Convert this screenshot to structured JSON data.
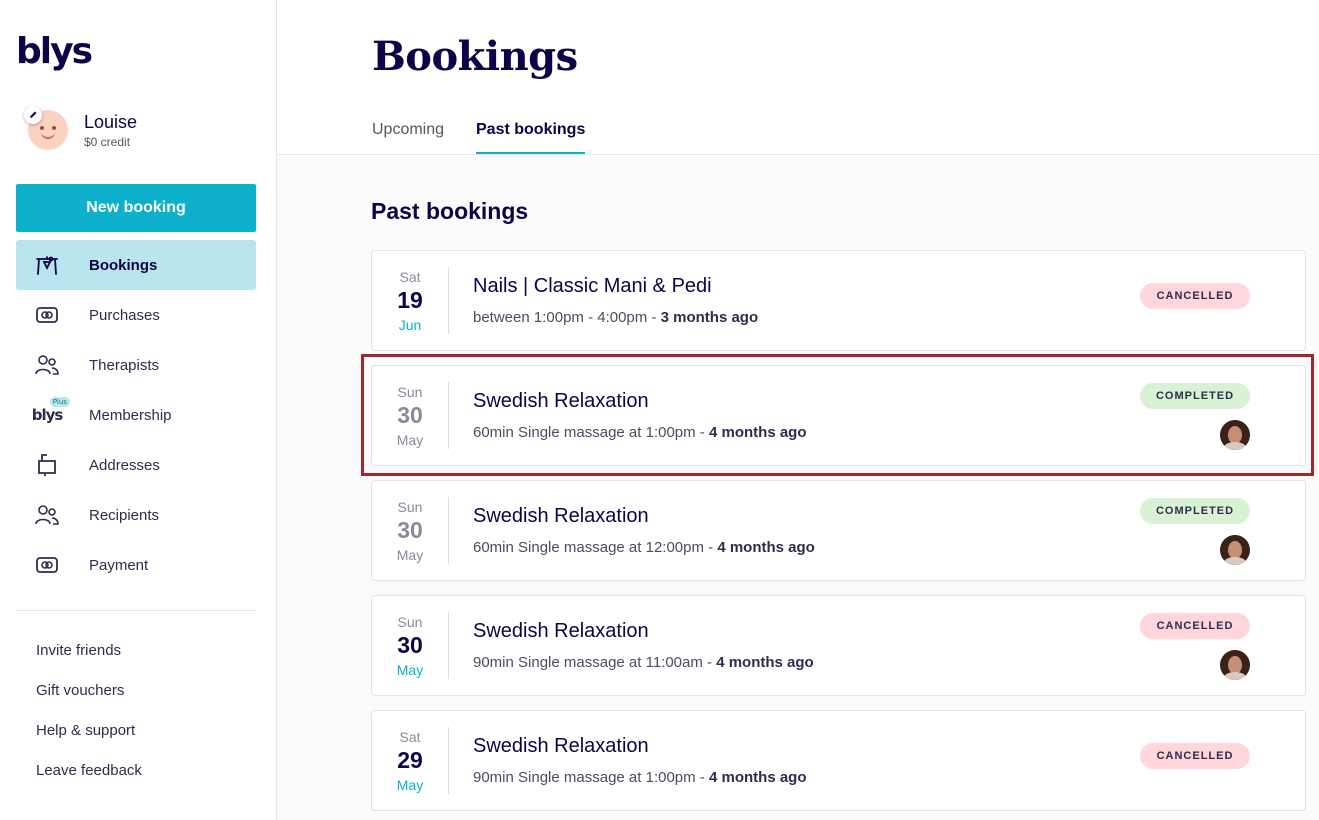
{
  "logo": "blys",
  "user": {
    "name": "Louise",
    "credit": "$0 credit"
  },
  "sidebar": {
    "new_booking_label": "New booking",
    "items": [
      {
        "label": "Bookings",
        "icon": "bookings-icon",
        "active": true
      },
      {
        "label": "Purchases",
        "icon": "purchases-icon",
        "active": false
      },
      {
        "label": "Therapists",
        "icon": "therapists-icon",
        "active": false
      },
      {
        "label": "Membership",
        "icon": "blys-plus-icon",
        "active": false
      },
      {
        "label": "Addresses",
        "icon": "mailbox-icon",
        "active": false
      },
      {
        "label": "Recipients",
        "icon": "recipients-icon",
        "active": false
      },
      {
        "label": "Payment",
        "icon": "payment-icon",
        "active": false
      }
    ],
    "plus_logo": "blys",
    "plus_tag": "Plus",
    "footer_links": [
      "Invite friends",
      "Gift vouchers",
      "Help & support",
      "Leave feedback"
    ]
  },
  "header": {
    "title": "Bookings",
    "tabs": [
      {
        "label": "Upcoming",
        "active": false
      },
      {
        "label": "Past bookings",
        "active": true
      }
    ]
  },
  "main": {
    "section_title": "Past bookings",
    "bookings": [
      {
        "dow": "Sat",
        "day": "19",
        "month": "Jun",
        "title": "Nails | Classic Mani & Pedi",
        "detail": "between 1:00pm - 4:00pm",
        "ago": "3 months ago",
        "status": "CANCELLED",
        "has_pro": false
      },
      {
        "dow": "Sun",
        "day": "30",
        "month": "May",
        "title": "Swedish Relaxation",
        "detail": "60min Single massage at 1:00pm",
        "ago": "4 months ago",
        "status": "COMPLETED",
        "has_pro": true
      },
      {
        "dow": "Sun",
        "day": "30",
        "month": "May",
        "title": "Swedish Relaxation",
        "detail": "60min Single massage at 12:00pm",
        "ago": "4 months ago",
        "status": "COMPLETED",
        "has_pro": true
      },
      {
        "dow": "Sun",
        "day": "30",
        "month": "May",
        "title": "Swedish Relaxation",
        "detail": "90min Single massage at 11:00am",
        "ago": "4 months ago",
        "status": "CANCELLED",
        "has_pro": true
      },
      {
        "dow": "Sat",
        "day": "29",
        "month": "May",
        "title": "Swedish Relaxation",
        "detail": "90min Single massage at 1:00pm",
        "ago": "4 months ago",
        "status": "CANCELLED",
        "has_pro": false
      }
    ],
    "separator": " - "
  },
  "colors": {
    "accent": "#0cb0cb",
    "navy": "#100249",
    "cancelled": "#ffd6dc",
    "completed": "#d9f2d4",
    "highlight": "#a0262f"
  }
}
